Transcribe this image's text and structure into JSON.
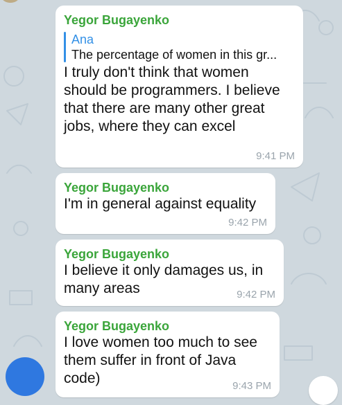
{
  "colors": {
    "background": "#cfd8de",
    "sender": "#3aa53a",
    "reply_accent": "#3390e6",
    "avatar": "#2f78e0"
  },
  "messages": [
    {
      "sender": "Yegor Bugayenko",
      "reply": {
        "name": "Ana",
        "text": "The percentage of women in this gr..."
      },
      "text": "I truly don't think that women should be programmers. I believe that there are many other great jobs, where they can excel",
      "time": "9:41 PM"
    },
    {
      "sender": "Yegor Bugayenko",
      "text": "I'm in general against equality",
      "time": "9:42 PM"
    },
    {
      "sender": "Yegor Bugayenko",
      "text": "I believe it only damages us, in many areas",
      "time": "9:42 PM"
    },
    {
      "sender": "Yegor Bugayenko",
      "text": "I love women too much to see them suffer in front of Java code)",
      "time": "9:43 PM"
    }
  ]
}
